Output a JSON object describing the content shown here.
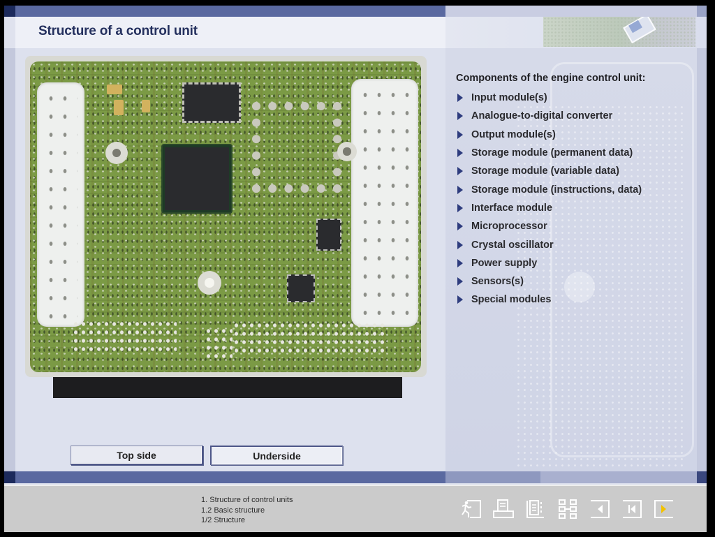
{
  "header": {
    "title": "Structure of a control unit"
  },
  "components": {
    "heading": "Components of the engine control unit:",
    "items": [
      "Input module(s)",
      "Analogue-to-digital converter",
      "Output module(s)",
      "Storage module (permanent data)",
      "Storage module (variable data)",
      "Storage module (instructions, data)",
      "Interface module",
      "Microprocessor",
      "Crystal oscillator",
      "Power supply",
      "Sensors(s)",
      "Special modules"
    ]
  },
  "image": {
    "subject": "engine control unit circuit board (top side)"
  },
  "view_buttons": {
    "top_side": "Top side",
    "underside": "Underside"
  },
  "footer": {
    "breadcrumbs": [
      "1. Structure of control units",
      "1.2 Basic structure",
      "1/2 Structure"
    ],
    "nav_icons": [
      {
        "name": "exit-icon"
      },
      {
        "name": "print-icon"
      },
      {
        "name": "glossary-icon"
      },
      {
        "name": "sitemap-icon"
      },
      {
        "name": "back-icon"
      },
      {
        "name": "first-page-icon"
      },
      {
        "name": "next-icon"
      }
    ]
  },
  "colors": {
    "title": "#24305e",
    "accent_bar": "#5a69a0",
    "dark_accent": "#1c2a5c",
    "bullet": "#2e3c7e",
    "next_arrow": "#f2c200",
    "footer_bg": "#cbcbcb"
  }
}
